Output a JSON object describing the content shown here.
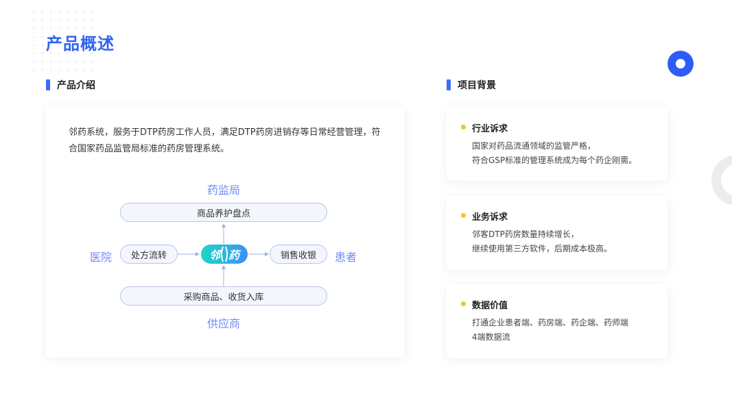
{
  "page": {
    "title": "产品概述"
  },
  "left": {
    "heading": "产品介绍",
    "intro": "邻药系统，服务于DTP药房工作人员，满足DTP药房进销存等日常经营管理，符合国家药品监管局标准的药房管理系统。",
    "diagram": {
      "top_label": "药监局",
      "bottom_label": "供应商",
      "left_label": "医院",
      "right_label": "患者",
      "top_box": "商品养护盘点",
      "bottom_box": "采购商品、收货入库",
      "left_box": "处方流转",
      "right_box": "销售收银",
      "center_char_1": "邻",
      "center_char_2": "药"
    }
  },
  "right": {
    "heading": "项目背景",
    "items": [
      {
        "title": "行业诉求",
        "line1": "国家对药品流通领域的监管严格，",
        "line2": "符合GSP标准的管理系统成为每个药企刚需。"
      },
      {
        "title": "业务诉求",
        "line1": "邻客DTP药房数量持续增长，",
        "line2": "继续使用第三方软件，后期成本极高。"
      },
      {
        "title": "数据价值",
        "line1": "打通企业患者端、药房端、药企端、药师端",
        "line2": "4端数据流"
      }
    ]
  },
  "colors": {
    "accent": "#2f63f2",
    "bullet": "#f5c518",
    "diagram_label": "#6f8bf2"
  }
}
